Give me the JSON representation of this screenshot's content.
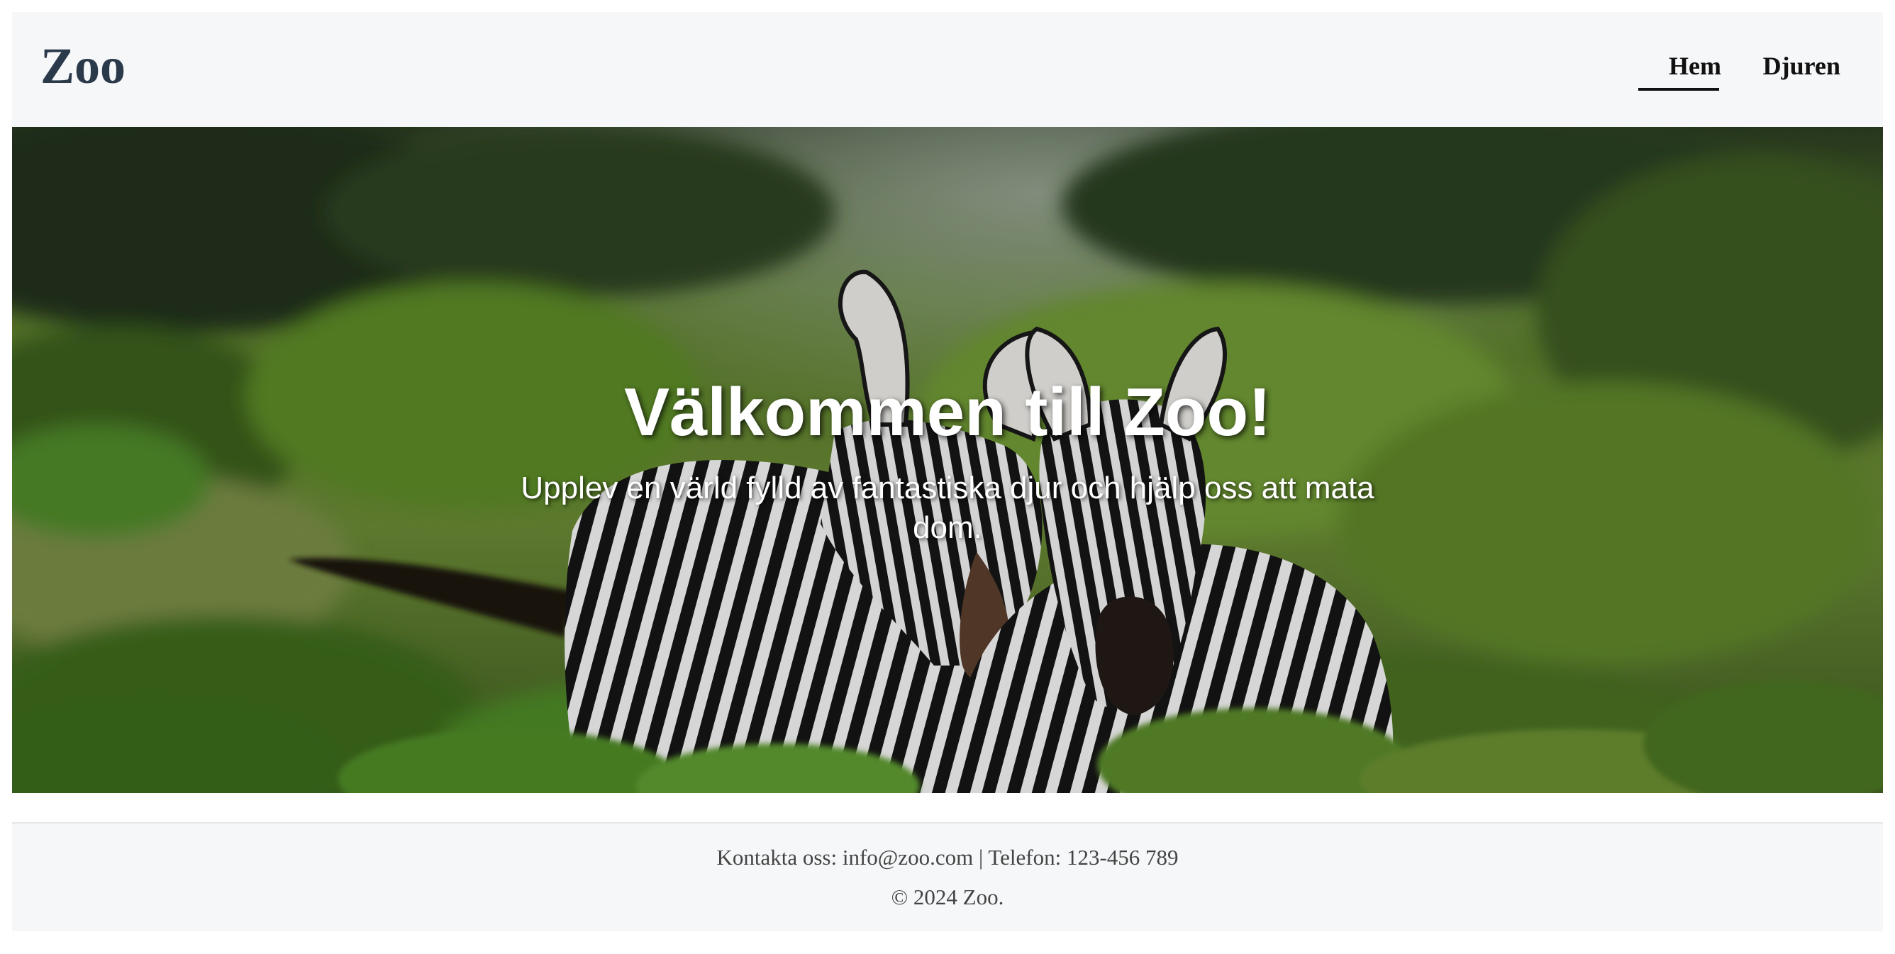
{
  "header": {
    "logo": "Zoo",
    "nav": [
      {
        "label": "Hem",
        "active": true
      },
      {
        "label": "Djuren",
        "active": false
      }
    ]
  },
  "hero": {
    "title": "Välkommen till Zoo!",
    "subtitle": "Upplev en värld fylld av fantastiska djur och hjälp oss att mata dom.",
    "image": "zebras-in-grassland"
  },
  "footer": {
    "contact_prefix": "Kontakta oss: ",
    "email": "info@zoo.com",
    "separator": " | ",
    "phone_prefix": "Telefon: ",
    "phone": "123-456 789",
    "copyright": "© 2024 Zoo."
  },
  "colors": {
    "header_bg": "#f6f7f9",
    "logo": "#2b3a4b",
    "nav_text": "#111111",
    "hero_text": "#ffffff",
    "footer_bg": "#f6f7f8",
    "footer_text": "#444444"
  }
}
